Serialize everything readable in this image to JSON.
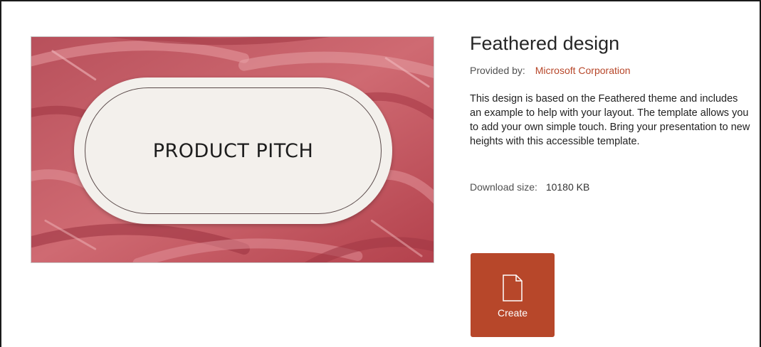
{
  "template": {
    "preview_title": "PRODUCT PITCH",
    "title": "Feathered design",
    "provided_by_label": "Provided by:",
    "provider": "Microsoft Corporation",
    "description": "This design is based on the Feathered theme and includes an example to help with your layout. The template allows you to add your own simple touch. Bring your presentation to new heights with this accessible template.",
    "download_size_label": "Download size:",
    "download_size": "10180 KB"
  },
  "actions": {
    "create_label": "Create",
    "create_icon": "document-icon"
  },
  "colors": {
    "accent": "#b7472a",
    "preview_bg": "#c0515c",
    "pill_bg": "#f3f0ec"
  }
}
